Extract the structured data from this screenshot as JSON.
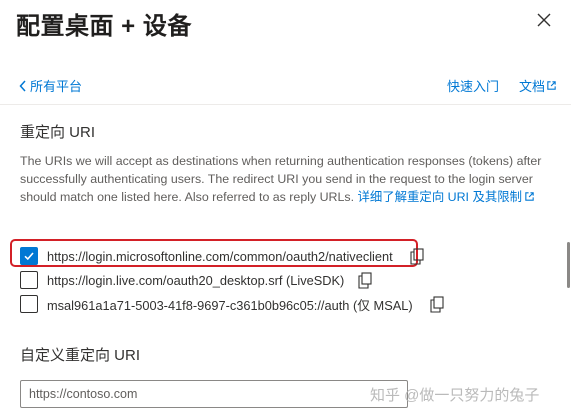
{
  "header": {
    "title": "配置桌面 + 设备",
    "close_icon": "close-icon"
  },
  "nav": {
    "back_label": "所有平台",
    "quickstart_label": "快速入门",
    "docs_label": "文档"
  },
  "redirect": {
    "section_title": "重定向 URI",
    "description": "The URIs we will accept as destinations when returning authentication responses (tokens) after successfully authenticating users. The redirect URI you send in the request to the login server should match one listed here. Also referred to as reply URLs.",
    "learn_more_link": "详细了解重定向 URI 及其限制",
    "uris": [
      {
        "uri": "https://login.microsoftonline.com/common/oauth2/nativeclient",
        "checked": true
      },
      {
        "uri": "https://login.live.com/oauth20_desktop.srf (LiveSDK)",
        "checked": false
      },
      {
        "uri": "msal961a1a71-5003-41f8-9697-c361b0b96c05://auth (仅 MSAL)",
        "checked": false
      }
    ]
  },
  "custom": {
    "title": "自定义重定向 URI",
    "input_value": "",
    "input_placeholder": "https://contoso.com"
  },
  "watermark": {
    "text": "知乎 @做一只努力的兔子"
  },
  "colors": {
    "accent": "#0078d4",
    "highlight": "#d32027"
  }
}
